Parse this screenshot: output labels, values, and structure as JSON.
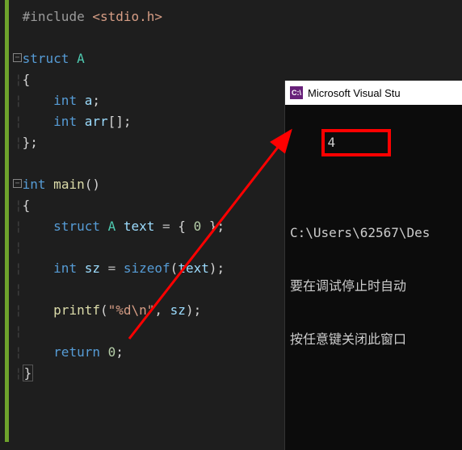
{
  "code": {
    "l1_pre": "#include ",
    "l1_hdr": "<stdio.h>",
    "l3_kw": "struct",
    "l3_cls": " A",
    "l4_brace": "{",
    "l5": "    int a;",
    "l5_kw": "int",
    "l5_id": " a",
    "l6_kw": "int",
    "l6_id": " arr",
    "l6_br": "[]",
    "l7_brace": "};",
    "l9_kw": "int",
    "l9_fn": " main",
    "l9_pr": "()",
    "l10_brace": "{",
    "l11_kw": "struct",
    "l11_cls": " A",
    "l11_id": " text ",
    "l11_eq": "= ",
    "l11_bo": "{ ",
    "l11_num": "0",
    "l11_bc": " };",
    "l13_kw": "int",
    "l13_id": " sz ",
    "l13_eq": "= ",
    "l13_fn": "sizeof",
    "l13_po": "(",
    "l13_arg": "text",
    "l13_pc": ");",
    "l15_fn": "printf",
    "l15_po": "(",
    "l15_str": "\"%d\\n\"",
    "l15_comma": ", ",
    "l15_arg": "sz",
    "l15_pc": ");",
    "l17_kw": "return",
    "l17_num": " 0",
    "l17_semi": ";",
    "l18_brace": "}"
  },
  "console": {
    "title": "Microsoft Visual Stu",
    "icon_text": "C:\\",
    "output": "4",
    "path": "C:\\Users\\62567\\Des",
    "msg1": "要在调试停止时自动",
    "msg2": "按任意键关闭此窗口"
  }
}
